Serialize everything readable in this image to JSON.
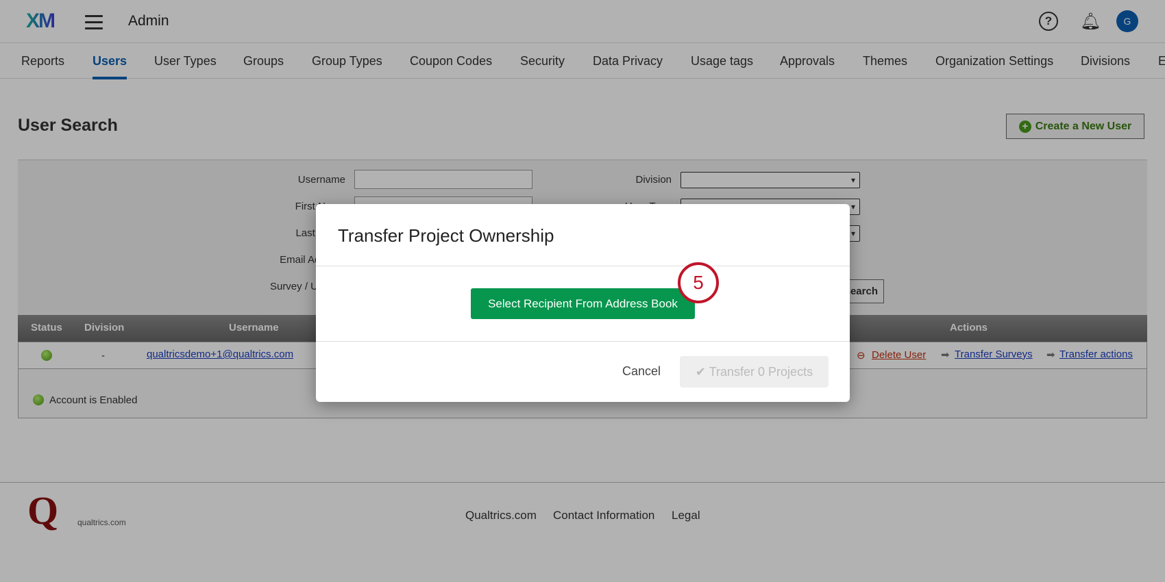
{
  "header": {
    "logo": "XM",
    "title": "Admin",
    "help": "?",
    "avatar": "G"
  },
  "nav": {
    "tabs": [
      "Reports",
      "Users",
      "User Types",
      "Groups",
      "Group Types",
      "Coupon Codes",
      "Security",
      "Data Privacy",
      "Usage tags",
      "Approvals",
      "Themes",
      "Organization Settings",
      "Divisions",
      "E"
    ],
    "active": "Users"
  },
  "page": {
    "title": "User Search",
    "create_label": "Create a New User"
  },
  "search": {
    "labels": [
      "Username",
      "First Name",
      "Last Name",
      "Email Address",
      "Survey / User ID"
    ],
    "right_labels": [
      "Division",
      "User Type"
    ],
    "search_label": "Search"
  },
  "table": {
    "headers": [
      "Status",
      "Division",
      "Username",
      "Actions"
    ],
    "row": {
      "division": "-",
      "username": "qualtricsdemo+1@qualtrics.com",
      "delete": "Delete User",
      "transfer_surveys": "Transfer Surveys",
      "transfer_actions": "Transfer actions"
    },
    "legend": "Account is Enabled"
  },
  "footer": {
    "logo_text": "qualtrics.com",
    "links": [
      "Qualtrics.com",
      "Contact Information",
      "Legal"
    ]
  },
  "modal": {
    "title": "Transfer Project Ownership",
    "select_label": "Select Recipient From Address Book",
    "cancel": "Cancel",
    "transfer": "Transfer 0 Projects",
    "step": "5"
  }
}
